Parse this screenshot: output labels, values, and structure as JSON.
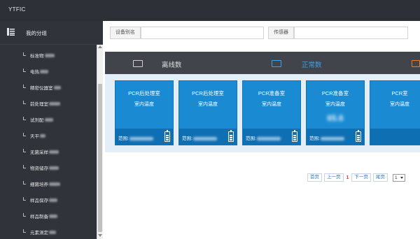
{
  "app": {
    "title": "YTFIC"
  },
  "sidebar": {
    "header_label": "我的分组",
    "header_icon": "grouped-list-icon",
    "items": [
      {
        "label": "标准物"
      },
      {
        "label": "电热"
      },
      {
        "label": "精密仪器室"
      },
      {
        "label": "前处理室"
      },
      {
        "label": "试剂配"
      },
      {
        "label": "天平"
      },
      {
        "label": "无菌采样"
      },
      {
        "label": "物资储存"
      },
      {
        "label": "细菌培养"
      },
      {
        "label": "样品保存"
      },
      {
        "label": "样品制备"
      },
      {
        "label": "元素测定"
      }
    ]
  },
  "filter": {
    "device_alias_label": "设备别名",
    "device_alias_value": "",
    "sensor_label": "传感器",
    "sensor_value": ""
  },
  "status": {
    "offline_label": "离线数",
    "offline_icon": "monitor-icon",
    "normal_label": "正常数",
    "normal_icon": "monitor-icon",
    "colors": {
      "offline": "#d0d0d0",
      "normal": "#3aa2e6",
      "alert": "#ef7d22"
    }
  },
  "cards": [
    {
      "title": "PCR后处理室",
      "subtitle": "室内温度",
      "value": "",
      "range_label": "范围:"
    },
    {
      "title": "PCR后处理室",
      "subtitle": "室内温度",
      "value": "",
      "range_label": "范围:"
    },
    {
      "title": "PCR准备室",
      "subtitle": "室内温度",
      "value": "",
      "range_label": "范围:"
    },
    {
      "title": "PCR准备室",
      "subtitle": "室内温度",
      "value": "65.6",
      "range_label": "范围:"
    },
    {
      "title": "PCR室",
      "subtitle": "室内温度",
      "value": "",
      "range_label": "范围:"
    }
  ],
  "pagination": {
    "first": "首页",
    "prev": "上一页",
    "current": "1",
    "next": "下一页",
    "last": "尾页",
    "page_select": "1"
  }
}
